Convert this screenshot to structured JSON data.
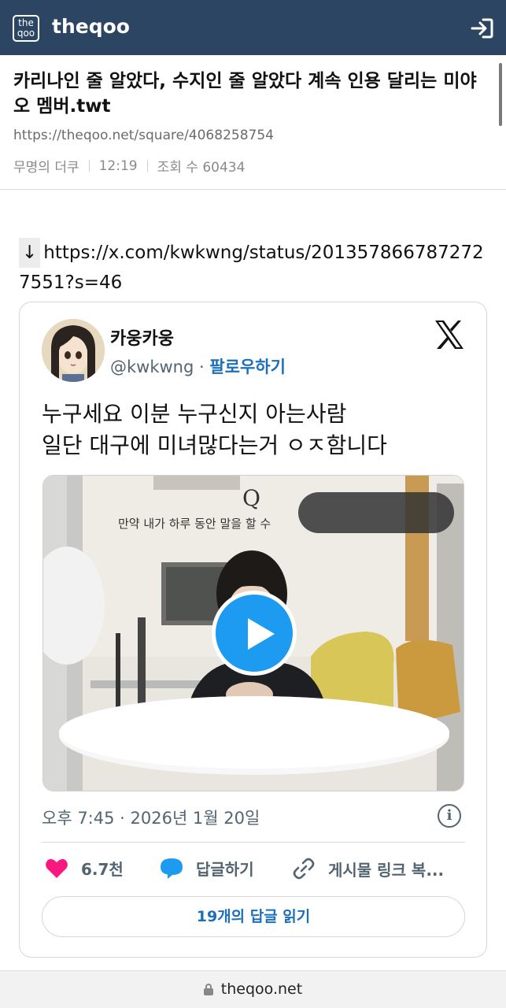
{
  "topbar": {
    "logo_line1": "the",
    "logo_line2": "qoo",
    "brand": "theqoo",
    "login_icon": "login-arrow-icon",
    "background": "#2b4563"
  },
  "article": {
    "title": "카리나인 줄 알았다, 수지인 줄 알았다 계속 인용 달리는 미야오 멤버.twt",
    "url": "https://theqoo.net/square/4068258754",
    "author": "무명의 더쿠",
    "time": "12:19",
    "views": "조회 수 60434"
  },
  "body": {
    "arrow": "↓",
    "link": "https://x.com/kwkwng/status/2013578667872727551?s=46"
  },
  "tweet": {
    "display_name": "카웅카웅",
    "handle": "@kwkwng",
    "dot": " · ",
    "follow": "팔로우하기",
    "text_line1": "누구세요 이분 누구신지 아는사람",
    "text_line2": "일단 대구에 미녀많다는거 ㅇㅈ함니다",
    "video": {
      "q": "Q",
      "caption": "만약 내가 하루 동안 말을 할 수"
    },
    "timestamp": "오후 7:45 · 2026년 1월 20일",
    "actions": {
      "likes": "6.7천",
      "reply": "답글하기",
      "share_link": "게시물 링크 복..."
    },
    "read_replies": "19개의 답글 읽기",
    "accent": "#1d9bf0",
    "like_color": "#f91880"
  },
  "bottombar": {
    "domain": "theqoo.net"
  }
}
